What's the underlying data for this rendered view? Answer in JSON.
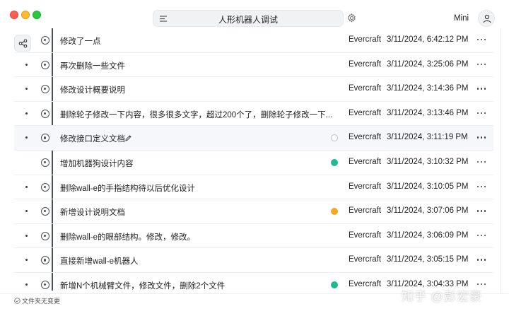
{
  "window": {
    "title": "人形机器人调试",
    "mode_label": "Mini"
  },
  "icons": {
    "menu": "menu-icon",
    "settings": "gear-icon",
    "avatar": "user-icon",
    "graph": "share-graph-icon",
    "edit": "pencil-icon",
    "more": "ellipsis-icon",
    "status_ok": "check-circle-icon"
  },
  "colors": {
    "status_green": "#1fba93",
    "status_orange": "#f5a623",
    "status_hollow": "#b9bec5"
  },
  "commits": [
    {
      "message": "修改了一点",
      "author": "Evercraft",
      "date": "3/11/2024, 6:42:12 PM",
      "status": "none",
      "editable": false
    },
    {
      "message": "再次删除一些文件",
      "author": "Evercraft",
      "date": "3/11/2024, 3:25:06 PM",
      "status": "none",
      "editable": false
    },
    {
      "message": "修改设计概要说明",
      "author": "Evercraft",
      "date": "3/11/2024, 3:14:36 PM",
      "status": "none",
      "editable": false
    },
    {
      "message": "删除轮子修改一下内容，很多很多文字，超过200个了，删除轮子修改一下...",
      "author": "Evercraft",
      "date": "3/11/2024, 3:13:46 PM",
      "status": "none",
      "editable": false
    },
    {
      "message": "修改接口定义文档",
      "author": "Evercraft",
      "date": "3/11/2024, 3:11:19 PM",
      "status": "hollow",
      "editable": true
    },
    {
      "message": "增加机器狗设计内容",
      "author": "Evercraft",
      "date": "3/11/2024, 3:10:32 PM",
      "status": "green",
      "editable": false
    },
    {
      "message": "删除wall-e的手指结构待以后优化设计",
      "author": "Evercraft",
      "date": "3/11/2024, 3:10:05 PM",
      "status": "none",
      "editable": false
    },
    {
      "message": "新增设计说明文档",
      "author": "Evercraft",
      "date": "3/11/2024, 3:07:06 PM",
      "status": "orange",
      "editable": false
    },
    {
      "message": "删除wall-e的眼部结构。修改，修改。",
      "author": "Evercraft",
      "date": "3/11/2024, 3:06:09 PM",
      "status": "none",
      "editable": false
    },
    {
      "message": "直接新增wall-e机器人",
      "author": "Evercraft",
      "date": "3/11/2024, 3:05:15 PM",
      "status": "none",
      "editable": false
    },
    {
      "message": "新增N个机械臂文件，修改文件，删除2个文件",
      "author": "Evercraft",
      "date": "3/11/2024, 3:04:33 PM",
      "status": "green",
      "editable": false
    }
  ],
  "footer": {
    "status_text": "文件夹无变更"
  },
  "watermark": "知乎 @彭宏豪"
}
